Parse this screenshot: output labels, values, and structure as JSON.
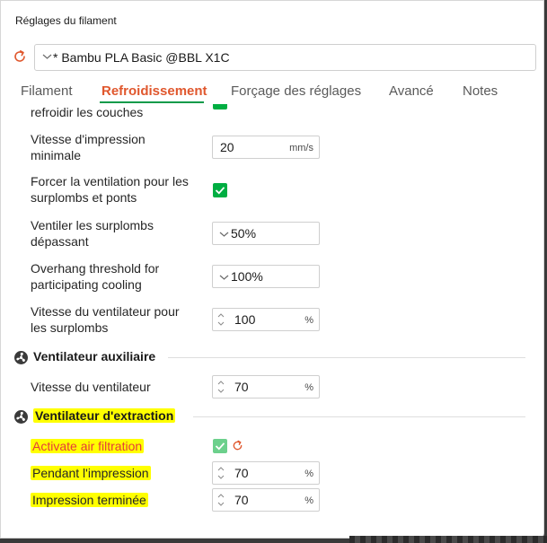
{
  "window": {
    "title": "Réglages du filament"
  },
  "preset": {
    "name": "* Bambu PLA Basic @BBL X1C"
  },
  "tabs": [
    {
      "label": "Filament"
    },
    {
      "label": "Refroidissement"
    },
    {
      "label": "Forçage des réglages"
    },
    {
      "label": "Avancé"
    },
    {
      "label": "Notes"
    }
  ],
  "settings": {
    "clipped_label": "refroidir les couches",
    "min_print_speed": {
      "label_1": "Vitesse d'impression",
      "label_2": "minimale",
      "value": "20",
      "unit": "mm/s"
    },
    "force_overhang": {
      "label_1": "Forcer la ventilation pour les",
      "label_2": "surplombs et ponts"
    },
    "overhang_threshold": {
      "label_1": "Ventiler les surplombs",
      "label_2": "dépassant",
      "value": "50%"
    },
    "overhang_participating": {
      "label_1": "Overhang threshold for",
      "label_2": "participating cooling",
      "value": "100%"
    },
    "overhang_fan_speed": {
      "label_1": "Vitesse du ventilateur pour",
      "label_2": "les surplombs",
      "value": "100",
      "unit": "%"
    }
  },
  "aux_fan": {
    "title": "Ventilateur auxiliaire",
    "speed": {
      "label": "Vitesse du ventilateur",
      "value": "70",
      "unit": "%"
    }
  },
  "exhaust_fan": {
    "title": "Ventilateur d'extraction",
    "air_filtration": {
      "label": "Activate air filtration"
    },
    "during_print": {
      "label": "Pendant l'impression",
      "value": "70",
      "unit": "%"
    },
    "complete_print": {
      "label": "Impression terminée",
      "value": "70",
      "unit": "%"
    }
  },
  "colors": {
    "accent_orange": "#e0572d",
    "accent_green": "#00ae42",
    "highlight": "#ffff00"
  },
  "icons": {
    "reset": "reset-icon",
    "fan": "fan-icon",
    "chevron": "chevron-down-icon"
  }
}
